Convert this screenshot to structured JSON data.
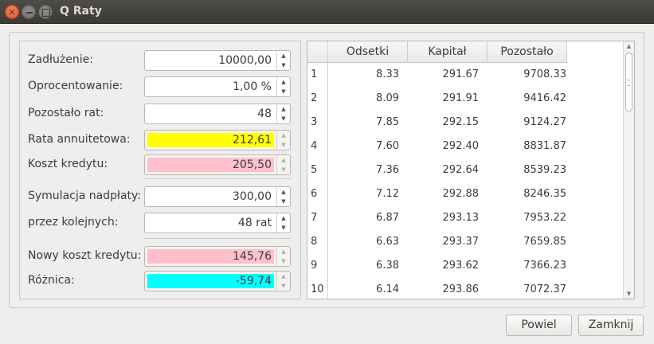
{
  "window": {
    "title": "Q Raty"
  },
  "form": {
    "rows": [
      {
        "label": "Zadłużenie:",
        "value": "10000,00",
        "bg": "#ffffff",
        "readonly": false
      },
      {
        "label": "Oprocentowanie:",
        "value": "1,00 %",
        "bg": "#ffffff",
        "readonly": false
      },
      {
        "label": "Pozostało rat:",
        "value": "48",
        "bg": "#ffffff",
        "readonly": false
      },
      {
        "label": "Rata annuitetowa:",
        "value": "212,61",
        "bg": "#ffff00",
        "readonly": true
      },
      {
        "label": "Koszt kredytu:",
        "value": "205,50",
        "bg": "#ffc0cb",
        "readonly": true
      },
      {
        "label": "Symulacja nadpłaty:",
        "value": "300,00",
        "bg": "#ffffff",
        "readonly": false
      },
      {
        "label": "przez kolejnych:",
        "value": "48 rat",
        "bg": "#ffffff",
        "readonly": false
      },
      {
        "label": "Nowy koszt kredytu:",
        "value": "145,76",
        "bg": "#ffc0cb",
        "readonly": true
      },
      {
        "label": "Różnica:",
        "value": "-59,74",
        "bg": "#00ffff",
        "readonly": true
      }
    ]
  },
  "table": {
    "columns": [
      "Odsetki",
      "Kapitał",
      "Pozostało"
    ],
    "rows": [
      [
        "1",
        "8.33",
        "291.67",
        "9708.33"
      ],
      [
        "2",
        "8.09",
        "291.91",
        "9416.42"
      ],
      [
        "3",
        "7.85",
        "292.15",
        "9124.27"
      ],
      [
        "4",
        "7.60",
        "292.40",
        "8831.87"
      ],
      [
        "5",
        "7.36",
        "292.64",
        "8539.23"
      ],
      [
        "6",
        "7.12",
        "292.88",
        "8246.35"
      ],
      [
        "7",
        "6.87",
        "293.13",
        "7953.22"
      ],
      [
        "8",
        "6.63",
        "293.37",
        "7659.85"
      ],
      [
        "9",
        "6.38",
        "293.62",
        "7366.23"
      ],
      [
        "10",
        "6.14",
        "293.86",
        "7072.37"
      ]
    ]
  },
  "buttons": {
    "reset": "Powiel",
    "close": "Zamknij"
  },
  "icons": {
    "close": "close-icon",
    "minimize": "minimize-icon",
    "maximize": "maximize-icon"
  }
}
